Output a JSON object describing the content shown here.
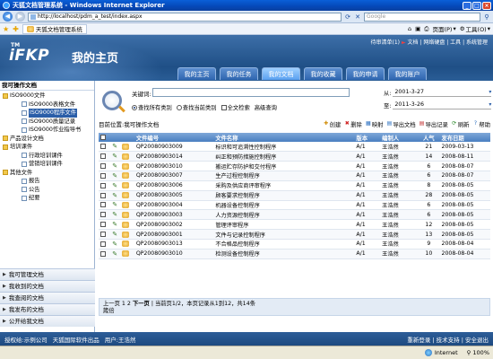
{
  "window": {
    "title": "天狐文档管理系统 - Windows Internet Explorer",
    "minimize": "_",
    "maximize": "□",
    "close": "×"
  },
  "browser": {
    "address": "http://localhost/pdm_a_test/index.aspx",
    "search_placeholder": "Google",
    "tab_title": "天狐文档管理系统",
    "tools": {
      "page": "页面(P)",
      "tools": "工具(O)"
    }
  },
  "header": {
    "logo_tm": "TM",
    "logo_main": "iFKP",
    "logo_sub": "我的主页",
    "user_line": {
      "user": "待审清单(1)",
      "arrow": "►",
      "links": "文档 | 网络硬盘 | 工具 | 系统管理"
    },
    "nav_tabs": [
      {
        "label": "我的主页",
        "active": false
      },
      {
        "label": "我的任务",
        "active": false
      },
      {
        "label": "我的文档",
        "active": true
      },
      {
        "label": "我的收藏",
        "active": false
      },
      {
        "label": "我的申请",
        "active": false
      },
      {
        "label": "我的账户",
        "active": false
      }
    ]
  },
  "sidebar": {
    "title": "我可操作文档",
    "tree": [
      {
        "label": "ISO9000文件",
        "indent": 1,
        "icon": "folder",
        "selected": false
      },
      {
        "label": "ISO9000表格文件",
        "indent": 2,
        "icon": "doc",
        "selected": false
      },
      {
        "label": "ISO9000程序文件",
        "indent": 2,
        "icon": "doc",
        "selected": true
      },
      {
        "label": "ISO9000质量记录",
        "indent": 2,
        "icon": "doc",
        "selected": false
      },
      {
        "label": "ISO9000作业指导书",
        "indent": 2,
        "icon": "doc",
        "selected": false
      },
      {
        "label": "产品设计文档",
        "indent": 1,
        "icon": "folder",
        "selected": false
      },
      {
        "label": "培训课件",
        "indent": 1,
        "icon": "folder",
        "selected": false
      },
      {
        "label": "行政培训课件",
        "indent": 2,
        "icon": "doc",
        "selected": false
      },
      {
        "label": "营销培训课件",
        "indent": 2,
        "icon": "doc",
        "selected": false
      },
      {
        "label": "其他文件",
        "indent": 1,
        "icon": "folder",
        "selected": false
      },
      {
        "label": "报告",
        "indent": 2,
        "icon": "doc",
        "selected": false
      },
      {
        "label": "公告",
        "indent": 2,
        "icon": "doc",
        "selected": false
      },
      {
        "label": "纪要",
        "indent": 2,
        "icon": "doc",
        "selected": false
      }
    ],
    "accordion": [
      {
        "label": "我可管理文档"
      },
      {
        "label": "我收到的文档"
      },
      {
        "label": "我查阅的文档"
      },
      {
        "label": "我发布的文档"
      },
      {
        "label": "公开给我文档"
      }
    ]
  },
  "search": {
    "keyword_label": "关键词:",
    "keyword_value": "",
    "options": [
      {
        "label": "查找所有类别",
        "checked": true
      },
      {
        "label": "查找当前类别",
        "checked": false
      }
    ],
    "fulltext_label": "全文检索",
    "advanced_label": "高级查询",
    "from_label": "从:",
    "from_date": "2001-3-27",
    "to_label": "至:",
    "to_date": "2011-3-26"
  },
  "location": {
    "text": "目前位置:我可操作文档"
  },
  "actions": [
    {
      "label": "创建",
      "icon": "plus-icon",
      "glyph": "✚",
      "color": "#d08a00"
    },
    {
      "label": "删除",
      "icon": "delete-icon",
      "glyph": "✖",
      "color": "#d02020"
    },
    {
      "label": "映射",
      "icon": "map-icon",
      "glyph": "▦",
      "color": "#2a6fc0"
    },
    {
      "label": "导出文档",
      "icon": "export-doc-icon",
      "glyph": "▤",
      "color": "#2a6fc0"
    },
    {
      "label": "导出记录",
      "icon": "export-record-icon",
      "glyph": "▤",
      "color": "#c03030"
    },
    {
      "label": "刷新",
      "icon": "refresh-icon",
      "glyph": "⟳",
      "color": "#2a8a2a"
    },
    {
      "label": "帮助",
      "icon": "help-icon",
      "glyph": "?",
      "color": "#2a6fc0"
    }
  ],
  "table": {
    "headers": {
      "no": "文件编号",
      "name": "文件名称",
      "version": "版本",
      "author": "编制人",
      "count": "人气",
      "date": "发布日期"
    },
    "rows": [
      {
        "no": "QP20080903009",
        "name": "标识和可追溯性控制程序",
        "version": "A/1",
        "author": "王浩然",
        "count": "21",
        "date": "2009-03-13"
      },
      {
        "no": "QP20080903014",
        "name": "纠正和预防措施控制程序",
        "version": "A/1",
        "author": "王浩然",
        "count": "14",
        "date": "2008-08-11"
      },
      {
        "no": "QP20080903010",
        "name": "搬运贮存防护和交付程序",
        "version": "A/1",
        "author": "王浩然",
        "count": "6",
        "date": "2008-08-07"
      },
      {
        "no": "QP20080903007",
        "name": "生产过程控制程序",
        "version": "A/1",
        "author": "王浩然",
        "count": "6",
        "date": "2008-08-07"
      },
      {
        "no": "QP20080903006",
        "name": "采购及供应商评审程序",
        "version": "A/1",
        "author": "王浩然",
        "count": "8",
        "date": "2008-08-05"
      },
      {
        "no": "QP20080903005",
        "name": "顾客要求控制程序",
        "version": "A/1",
        "author": "王浩然",
        "count": "28",
        "date": "2008-08-05"
      },
      {
        "no": "QP20080903004",
        "name": "机器设备控制程序",
        "version": "A/1",
        "author": "王浩然",
        "count": "6",
        "date": "2008-08-05"
      },
      {
        "no": "QP20080903003",
        "name": "人力资源控制程序",
        "version": "A/1",
        "author": "王浩然",
        "count": "6",
        "date": "2008-08-05"
      },
      {
        "no": "QP20080903002",
        "name": "管理评审程序",
        "version": "A/1",
        "author": "王浩然",
        "count": "12",
        "date": "2008-08-05"
      },
      {
        "no": "QP20080903001",
        "name": "文件与记录控制程序",
        "version": "A/1",
        "author": "王浩然",
        "count": "13",
        "date": "2008-08-05"
      },
      {
        "no": "QP20080903013",
        "name": "不合格品控制程序",
        "version": "A/1",
        "author": "王浩然",
        "count": "9",
        "date": "2008-08-04"
      },
      {
        "no": "QP20080903010",
        "name": "检测设备控制程序",
        "version": "A/1",
        "author": "王浩然",
        "count": "10",
        "date": "2008-08-04"
      }
    ]
  },
  "pager": {
    "line1_links": "上一页 1 2",
    "next": "下一页",
    "line1_info": "| 当前页1/2，本页记录从1到12，共14条",
    "line2": "箴倍"
  },
  "footer": {
    "left": [
      "授权给:示例公司",
      "天狐国际软件出品",
      "用户:王浩然"
    ],
    "right": "重新登录 | 技术支持 | 安全退出"
  },
  "status": {
    "zone": "Internet",
    "zoom": "100%"
  }
}
